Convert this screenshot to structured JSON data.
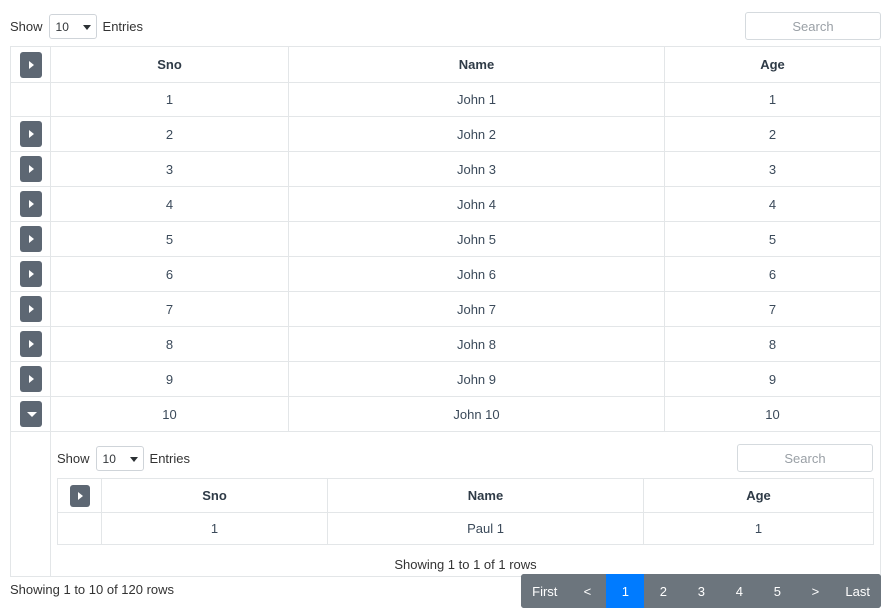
{
  "toolbar": {
    "show_label": "Show",
    "entries_label": "Entries",
    "page_size": "10",
    "search_placeholder": "Search"
  },
  "main_table": {
    "columns": [
      "Sno",
      "Name",
      "Age"
    ],
    "toggle_header_icon": "caret-right-icon",
    "rows": [
      {
        "toggle": "none",
        "sno": "1",
        "name": "John 1",
        "age": "1"
      },
      {
        "toggle": "right",
        "sno": "2",
        "name": "John 2",
        "age": "2"
      },
      {
        "toggle": "right",
        "sno": "3",
        "name": "John 3",
        "age": "3"
      },
      {
        "toggle": "right",
        "sno": "4",
        "name": "John 4",
        "age": "4"
      },
      {
        "toggle": "right",
        "sno": "5",
        "name": "John 5",
        "age": "5"
      },
      {
        "toggle": "right",
        "sno": "6",
        "name": "John 6",
        "age": "6"
      },
      {
        "toggle": "right",
        "sno": "7",
        "name": "John 7",
        "age": "7"
      },
      {
        "toggle": "right",
        "sno": "8",
        "name": "John 8",
        "age": "8"
      },
      {
        "toggle": "right",
        "sno": "9",
        "name": "John 9",
        "age": "9"
      },
      {
        "toggle": "down",
        "sno": "10",
        "name": "John 10",
        "age": "10"
      }
    ]
  },
  "detail_table": {
    "toolbar": {
      "show_label": "Show",
      "entries_label": "Entries",
      "page_size": "10",
      "search_placeholder": "Search"
    },
    "columns": [
      "Sno",
      "Name",
      "Age"
    ],
    "rows": [
      {
        "toggle": "none",
        "sno": "1",
        "name": "Paul 1",
        "age": "1"
      }
    ],
    "status": "Showing 1 to 1 of 1 rows"
  },
  "footer": {
    "status": "Showing 1 to 10 of 120 rows",
    "pagination": [
      {
        "label": "First",
        "active": false
      },
      {
        "label": "<",
        "active": false
      },
      {
        "label": "1",
        "active": true
      },
      {
        "label": "2",
        "active": false
      },
      {
        "label": "3",
        "active": false
      },
      {
        "label": "4",
        "active": false
      },
      {
        "label": "5",
        "active": false
      },
      {
        "label": ">",
        "active": false
      },
      {
        "label": "Last",
        "active": false
      }
    ]
  },
  "colors": {
    "accent": "#007bff",
    "pagination_bg": "#6c757d",
    "toggle_bg": "#5d6773",
    "border": "#e3e6e8"
  }
}
